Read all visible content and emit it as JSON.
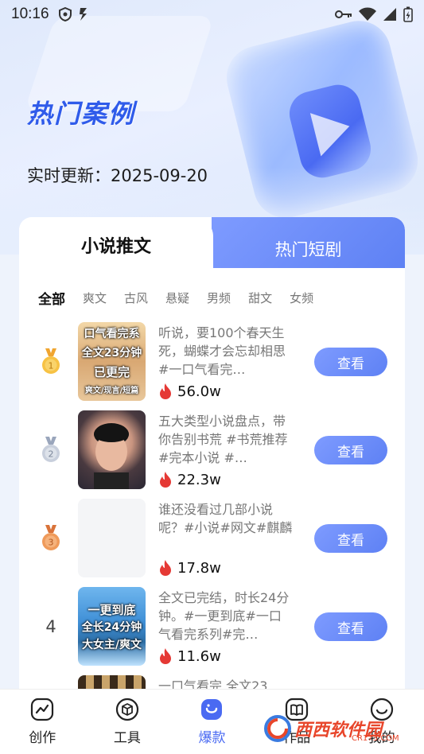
{
  "status_bar": {
    "time": "10:16"
  },
  "hero": {
    "title": "热门案例",
    "update_text": "实时更新：2025-09-20"
  },
  "tabs": [
    {
      "label": "小说推文",
      "active": true
    },
    {
      "label": "热门短剧",
      "active": false
    }
  ],
  "filters": [
    "全部",
    "爽文",
    "古风",
    "悬疑",
    "男频",
    "甜文",
    "女频"
  ],
  "items": [
    {
      "rank": "1",
      "thumb_lines": [
        "口气看完系",
        "全文23分钟",
        "已更完",
        "爽文/现言/短篇"
      ],
      "description": "听说，要100个春天生死，蝴蝶才会忘却相思 #一口气看完…",
      "heat": "56.0w",
      "button": "查看"
    },
    {
      "rank": "2",
      "thumb_lines": [],
      "description": "五大类型小说盘点，带你告别书荒 #书荒推荐 #完本小说 #…",
      "heat": "22.3w",
      "button": "查看"
    },
    {
      "rank": "3",
      "thumb_lines": [],
      "description": "谁还没看过几部小说呢？#小说#网文#麒麟",
      "heat": "17.8w",
      "button": "查看"
    },
    {
      "rank": "4",
      "thumb_lines": [
        "一更到底",
        "全长24分钟",
        "大女主/爽文"
      ],
      "description": "全文已完结，时长24分钟。#一更到底#一口气看完系列#完…",
      "heat": "11.6w",
      "button": "查看"
    },
    {
      "rank": "",
      "thumb_lines": [],
      "description": "一口气看完 全文23",
      "heat": "",
      "button": ""
    }
  ],
  "bottom_nav": [
    {
      "label": "创作",
      "icon": "chart-icon",
      "active": false
    },
    {
      "label": "工具",
      "icon": "box-icon",
      "active": false
    },
    {
      "label": "爆款",
      "icon": "flame-icon",
      "active": true
    },
    {
      "label": "作品",
      "icon": "book-icon",
      "active": false
    },
    {
      "label": "我的",
      "icon": "smile-icon",
      "active": false
    }
  ],
  "watermark": {
    "text": "西西软件园",
    "sub": "CR173.COM"
  },
  "colors": {
    "accent": "#4a6af2",
    "title_blue": "#2f5bea",
    "heat_red": "#e53935"
  }
}
